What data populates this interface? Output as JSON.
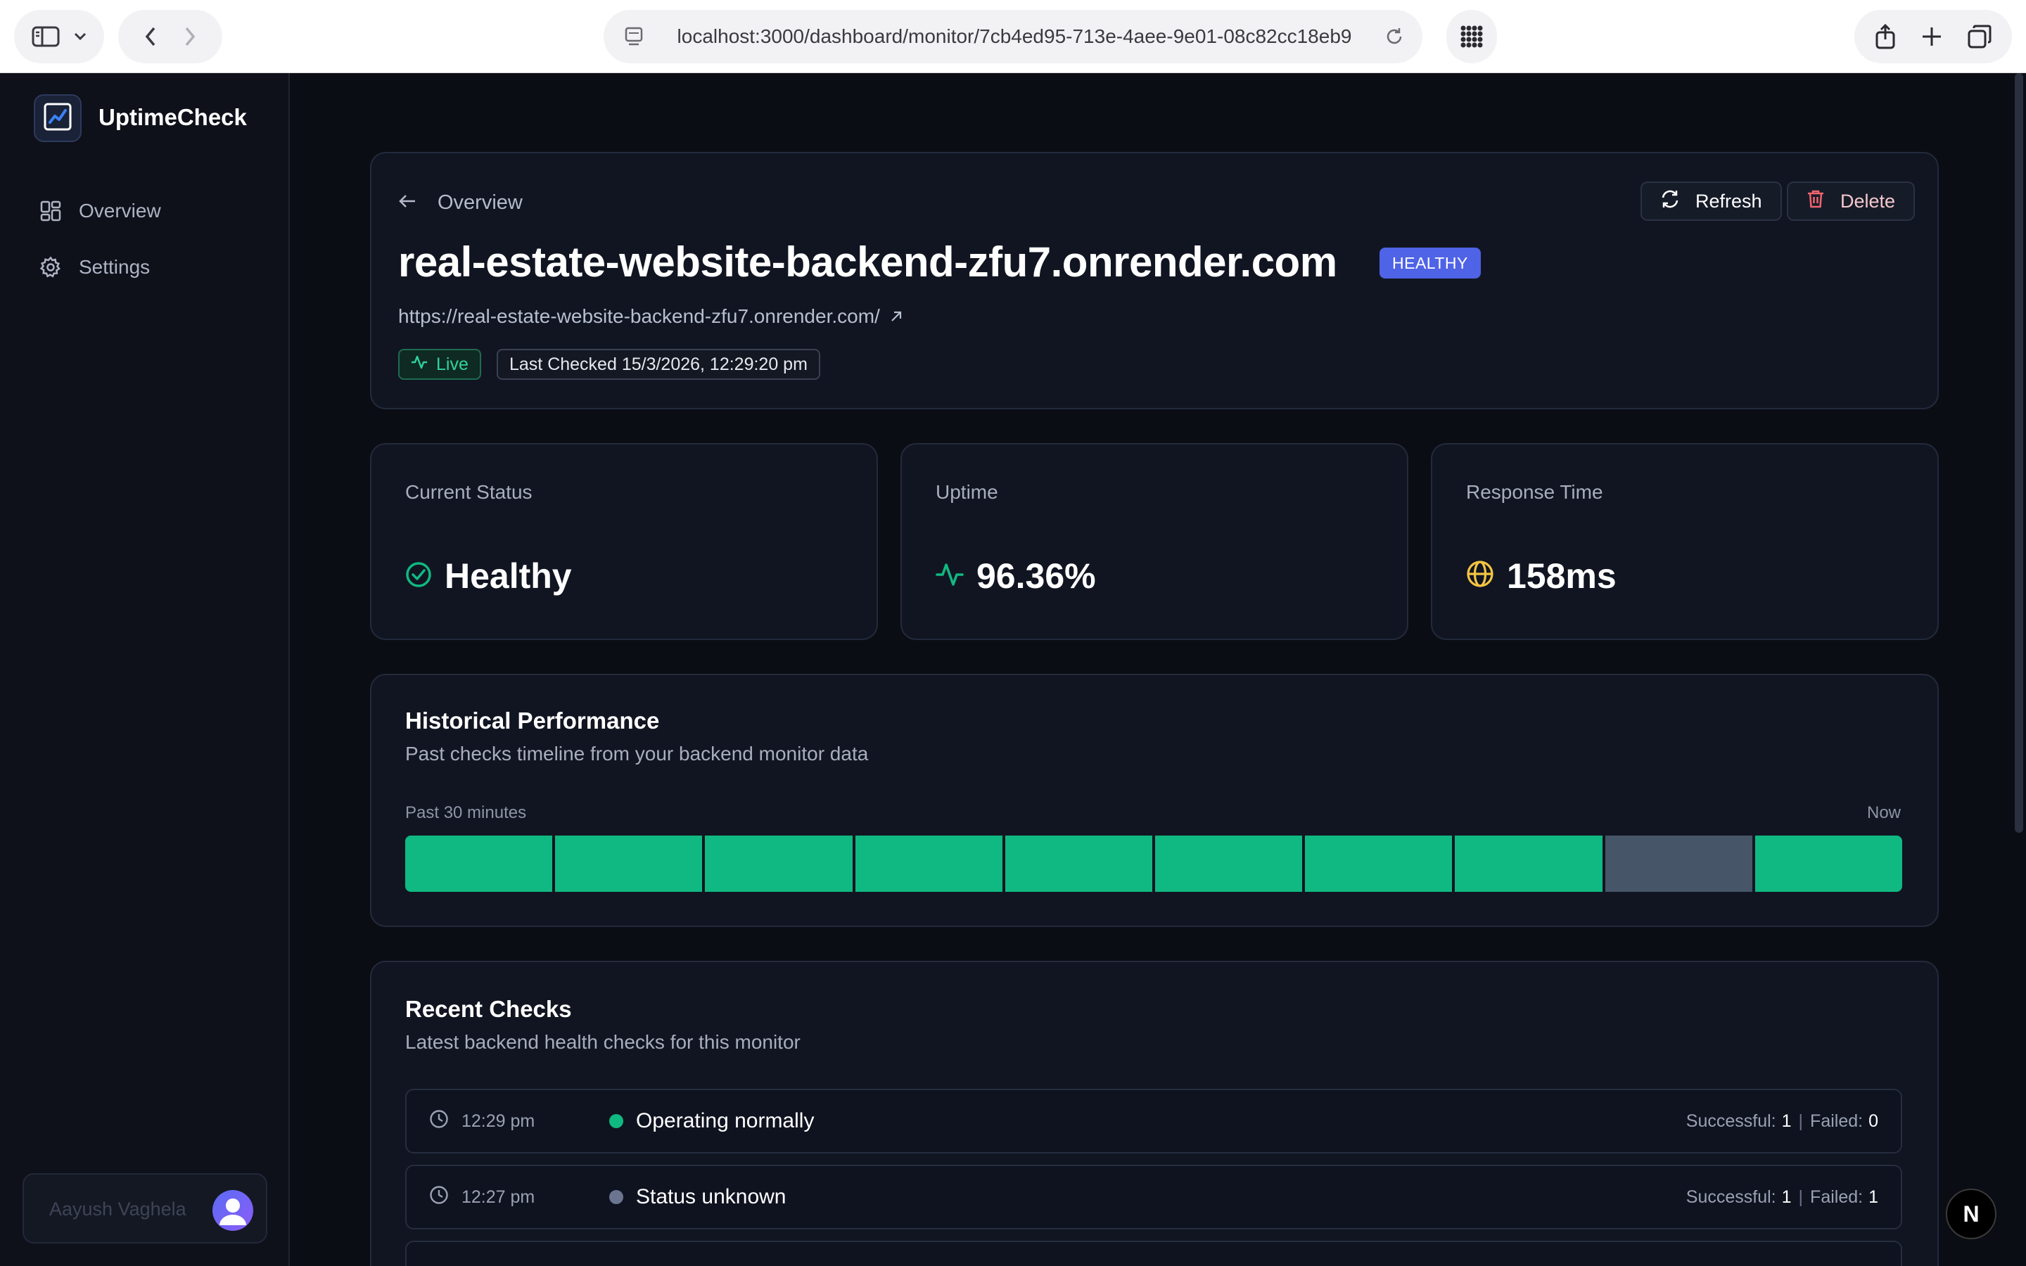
{
  "browser": {
    "url": "localhost:3000/dashboard/monitor/7cb4ed95-713e-4aee-9e01-08c82cc18eb9"
  },
  "sidebar": {
    "brand": "UptimeCheck",
    "items": [
      {
        "label": "Overview",
        "icon": "grid-icon"
      },
      {
        "label": "Settings",
        "icon": "gear-icon"
      }
    ],
    "user": {
      "name": "Aayush Vaghela"
    }
  },
  "header": {
    "back_label": "Overview",
    "refresh_label": "Refresh",
    "delete_label": "Delete",
    "title": "real-estate-website-backend-zfu7.onrender.com",
    "status_badge": "HEALTHY",
    "url": "https://real-estate-website-backend-zfu7.onrender.com/",
    "live_label": "Live",
    "last_checked": "Last Checked 15/3/2026, 12:29:20 pm"
  },
  "stats": [
    {
      "label": "Current Status",
      "value": "Healthy",
      "icon": "check-circle-icon"
    },
    {
      "label": "Uptime",
      "value": "96.36%",
      "icon": "activity-icon"
    },
    {
      "label": "Response Time",
      "value": "158ms",
      "icon": "globe-icon"
    }
  ],
  "history": {
    "title": "Historical Performance",
    "subtitle": "Past checks timeline from your backend monitor data",
    "range_start": "Past 30 minutes",
    "range_end": "Now",
    "segments": [
      "up",
      "up",
      "up",
      "up",
      "up",
      "up",
      "up",
      "up",
      "unknown",
      "up"
    ]
  },
  "recent": {
    "title": "Recent Checks",
    "subtitle": "Latest backend health checks for this monitor",
    "successful_label": "Successful:",
    "failed_label": "Failed:",
    "rows": [
      {
        "time": "12:29 pm",
        "status": "Operating normally",
        "state": "up",
        "successful": "1",
        "failed": "0"
      },
      {
        "time": "12:27 pm",
        "status": "Status unknown",
        "state": "unknown",
        "successful": "1",
        "failed": "1"
      }
    ]
  },
  "colors": {
    "accent": "#4f63e6",
    "up": "#10b981",
    "unknown": "#475569",
    "warning": "#f5c542"
  }
}
